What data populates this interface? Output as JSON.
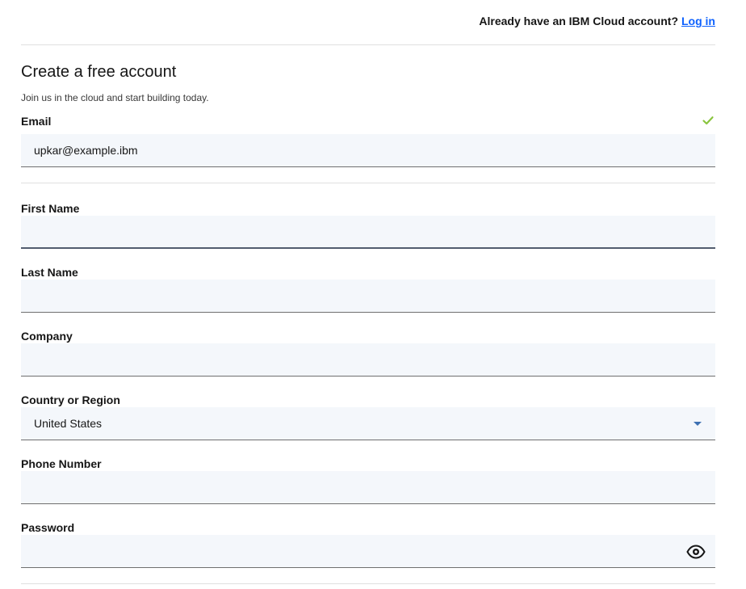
{
  "header": {
    "prompt": "Already have an IBM Cloud account?",
    "login_link": "Log in"
  },
  "form": {
    "title": "Create a free account",
    "subtitle": "Join us in the cloud and start building today.",
    "email": {
      "label": "Email",
      "value": "upkar@example.ibm",
      "valid": true
    },
    "first_name": {
      "label": "First Name",
      "value": ""
    },
    "last_name": {
      "label": "Last Name",
      "value": ""
    },
    "company": {
      "label": "Company",
      "value": ""
    },
    "country": {
      "label": "Country or Region",
      "value": "United States"
    },
    "phone": {
      "label": "Phone Number",
      "value": ""
    },
    "password": {
      "label": "Password",
      "value": ""
    }
  },
  "icons": {
    "email_status": "checkmark-icon",
    "country_dropdown": "chevron-down-icon",
    "password_toggle": "eye-icon"
  },
  "colors": {
    "link": "#0f62fe",
    "success": "#8ac53f",
    "field_bg": "#f4f7fb"
  }
}
